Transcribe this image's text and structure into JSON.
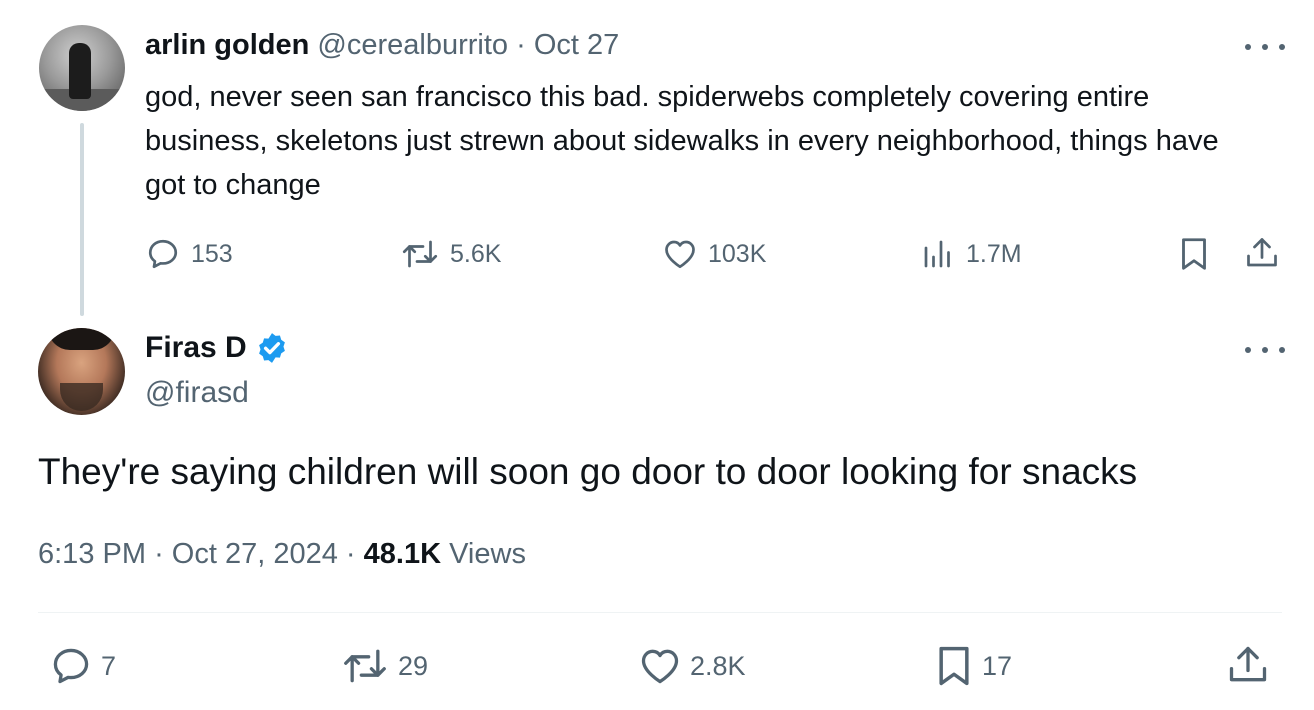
{
  "parent": {
    "name": "arlin golden",
    "handle": "@cerealburrito",
    "separator": "·",
    "date": "Oct 27",
    "text": "god, never seen san francisco this bad. spiderwebs completely covering entire business, skeletons just strewn about sidewalks in every neighborhood, things have got to change",
    "replies": "153",
    "reposts": "5.6K",
    "likes": "103K",
    "views": "1.7M"
  },
  "main": {
    "name": "Firas D",
    "verified": true,
    "handle": "@firasd",
    "text": "They're saying children will soon go door to door looking for snacks",
    "time": "6:13 PM",
    "date": "Oct 27, 2024",
    "separator": "·",
    "views_count": "48.1K",
    "views_label": "Views",
    "replies": "7",
    "reposts": "29",
    "likes": "2.8K",
    "bookmarks": "17"
  },
  "colors": {
    "text": "#0f1419",
    "muted": "#536471",
    "verified": "#1d9bf0",
    "thread_line": "#cfd9de"
  },
  "icons": [
    "reply-icon",
    "repost-icon",
    "like-icon",
    "views-icon",
    "bookmark-icon",
    "share-icon",
    "more-icon",
    "verified-badge-icon"
  ]
}
